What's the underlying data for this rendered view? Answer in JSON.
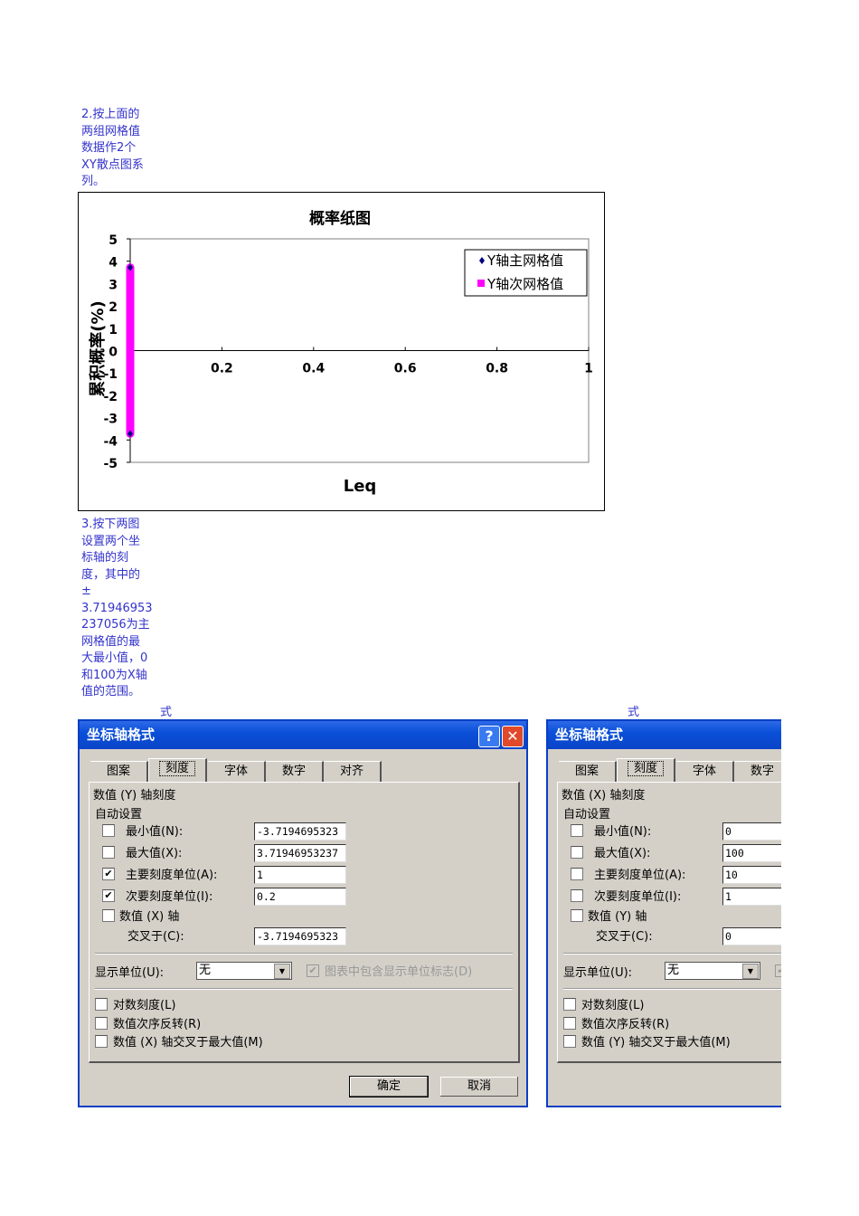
{
  "note2": {
    "lines": [
      "2.按上面的",
      "两组网格值",
      "数据作2个",
      "XY散点图系",
      "列。"
    ]
  },
  "note3": {
    "lines": [
      "3.按下两图",
      "设置两个坐",
      "标轴的刻",
      "度，其中的",
      "±",
      "3.71946953",
      "237056为主",
      "网格值的最",
      "大最小值，0",
      "和100为X轴",
      "值的范围。"
    ]
  },
  "caption_left": "式",
  "caption_right": "式",
  "chart_data": {
    "type": "scatter",
    "title": "概率纸图",
    "xlabel": "Leq",
    "ylabel": "累积概率(%)",
    "xlim": [
      0,
      1
    ],
    "ylim": [
      -5,
      5
    ],
    "x_ticks": [
      "0",
      "0.2",
      "0.4",
      "0.6",
      "0.8",
      "1"
    ],
    "y_ticks": [
      "5",
      "4",
      "3",
      "2",
      "1",
      "0",
      "-1",
      "-2",
      "-3",
      "-4",
      "-5"
    ],
    "legend_position": "top-right",
    "colors": {
      "main": "#000080",
      "minor": "#ff00ff"
    },
    "series": [
      {
        "name": "Y轴主网格值",
        "x": [
          0,
          0
        ],
        "y": [
          -3.7194695323,
          3.7194695323
        ]
      },
      {
        "name": "Y轴次网格值",
        "x": [
          0,
          0
        ],
        "y": [
          -3.7194695323,
          3.7194695323
        ]
      }
    ]
  },
  "dialog_left": {
    "title": "坐标轴格式",
    "help": "?",
    "close": "✕",
    "tabs": [
      "图案",
      "刻度",
      "字体",
      "数字",
      "对齐"
    ],
    "section": "数值 (Y) 轴刻度",
    "auto": "自动设置",
    "rows": [
      {
        "label": "最小值(N):",
        "checked": false,
        "value": "-3.7194695323"
      },
      {
        "label": "最大值(X):",
        "checked": false,
        "value": "3.71946953237"
      },
      {
        "label": "主要刻度单位(A):",
        "checked": true,
        "value": "1"
      },
      {
        "label": "次要刻度单位(I):",
        "checked": true,
        "value": "0.2"
      }
    ],
    "cross_axis": "数值 (X) 轴",
    "cross_label": "交叉于(C):",
    "cross_value": "-3.7194695323",
    "unit_label": "显示单位(U):",
    "unit_value": "无",
    "unit_flag": "图表中包含显示单位标志(D)",
    "opts": [
      "对数刻度(L)",
      "数值次序反转(R)",
      "数值 (X) 轴交叉于最大值(M)"
    ],
    "ok": "确定",
    "cancel": "取消"
  },
  "dialog_right": {
    "title": "坐标轴格式",
    "tabs": [
      "图案",
      "刻度",
      "字体",
      "数字"
    ],
    "section": "数值 (X) 轴刻度",
    "auto": "自动设置",
    "rows": [
      {
        "label": "最小值(N):",
        "checked": false,
        "value": "0"
      },
      {
        "label": "最大值(X):",
        "checked": false,
        "value": "100"
      },
      {
        "label": "主要刻度单位(A):",
        "checked": false,
        "value": "10"
      },
      {
        "label": "次要刻度单位(I):",
        "checked": false,
        "value": "1"
      }
    ],
    "cross_axis": "数值 (Y) 轴",
    "cross_label": "交叉于(C):",
    "cross_value": "0",
    "unit_label": "显示单位(U):",
    "unit_value": "无",
    "opts": [
      "对数刻度(L)",
      "数值次序反转(R)",
      "数值 (Y) 轴交叉于最大值(M)"
    ]
  }
}
